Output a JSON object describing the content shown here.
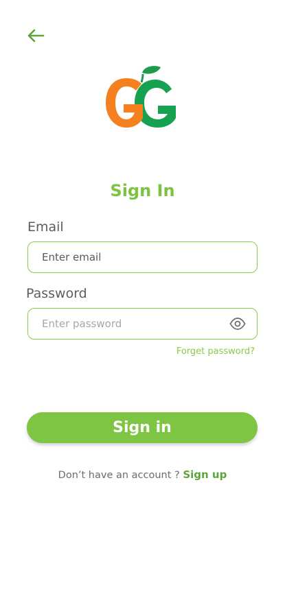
{
  "header": {
    "back_icon": "arrow-left-icon"
  },
  "logo": {
    "icon": "grocery-logo-icon",
    "colors": {
      "orange": "#f5801f",
      "green": "#17a252"
    }
  },
  "title": "Sign In",
  "email": {
    "label": "Email",
    "placeholder": "Enter email",
    "value": ""
  },
  "password": {
    "label": "Password",
    "placeholder": "Enter password",
    "value": "",
    "toggle_icon": "eye-icon"
  },
  "forgot_password": "Forget password?",
  "signin_button": "Sign in",
  "signup": {
    "prompt": "Don’t have an account ?",
    "link": "Sign up"
  },
  "colors": {
    "accent": "#7ec544",
    "accent_dark": "#5ca53a",
    "border": "#8cc84b"
  }
}
